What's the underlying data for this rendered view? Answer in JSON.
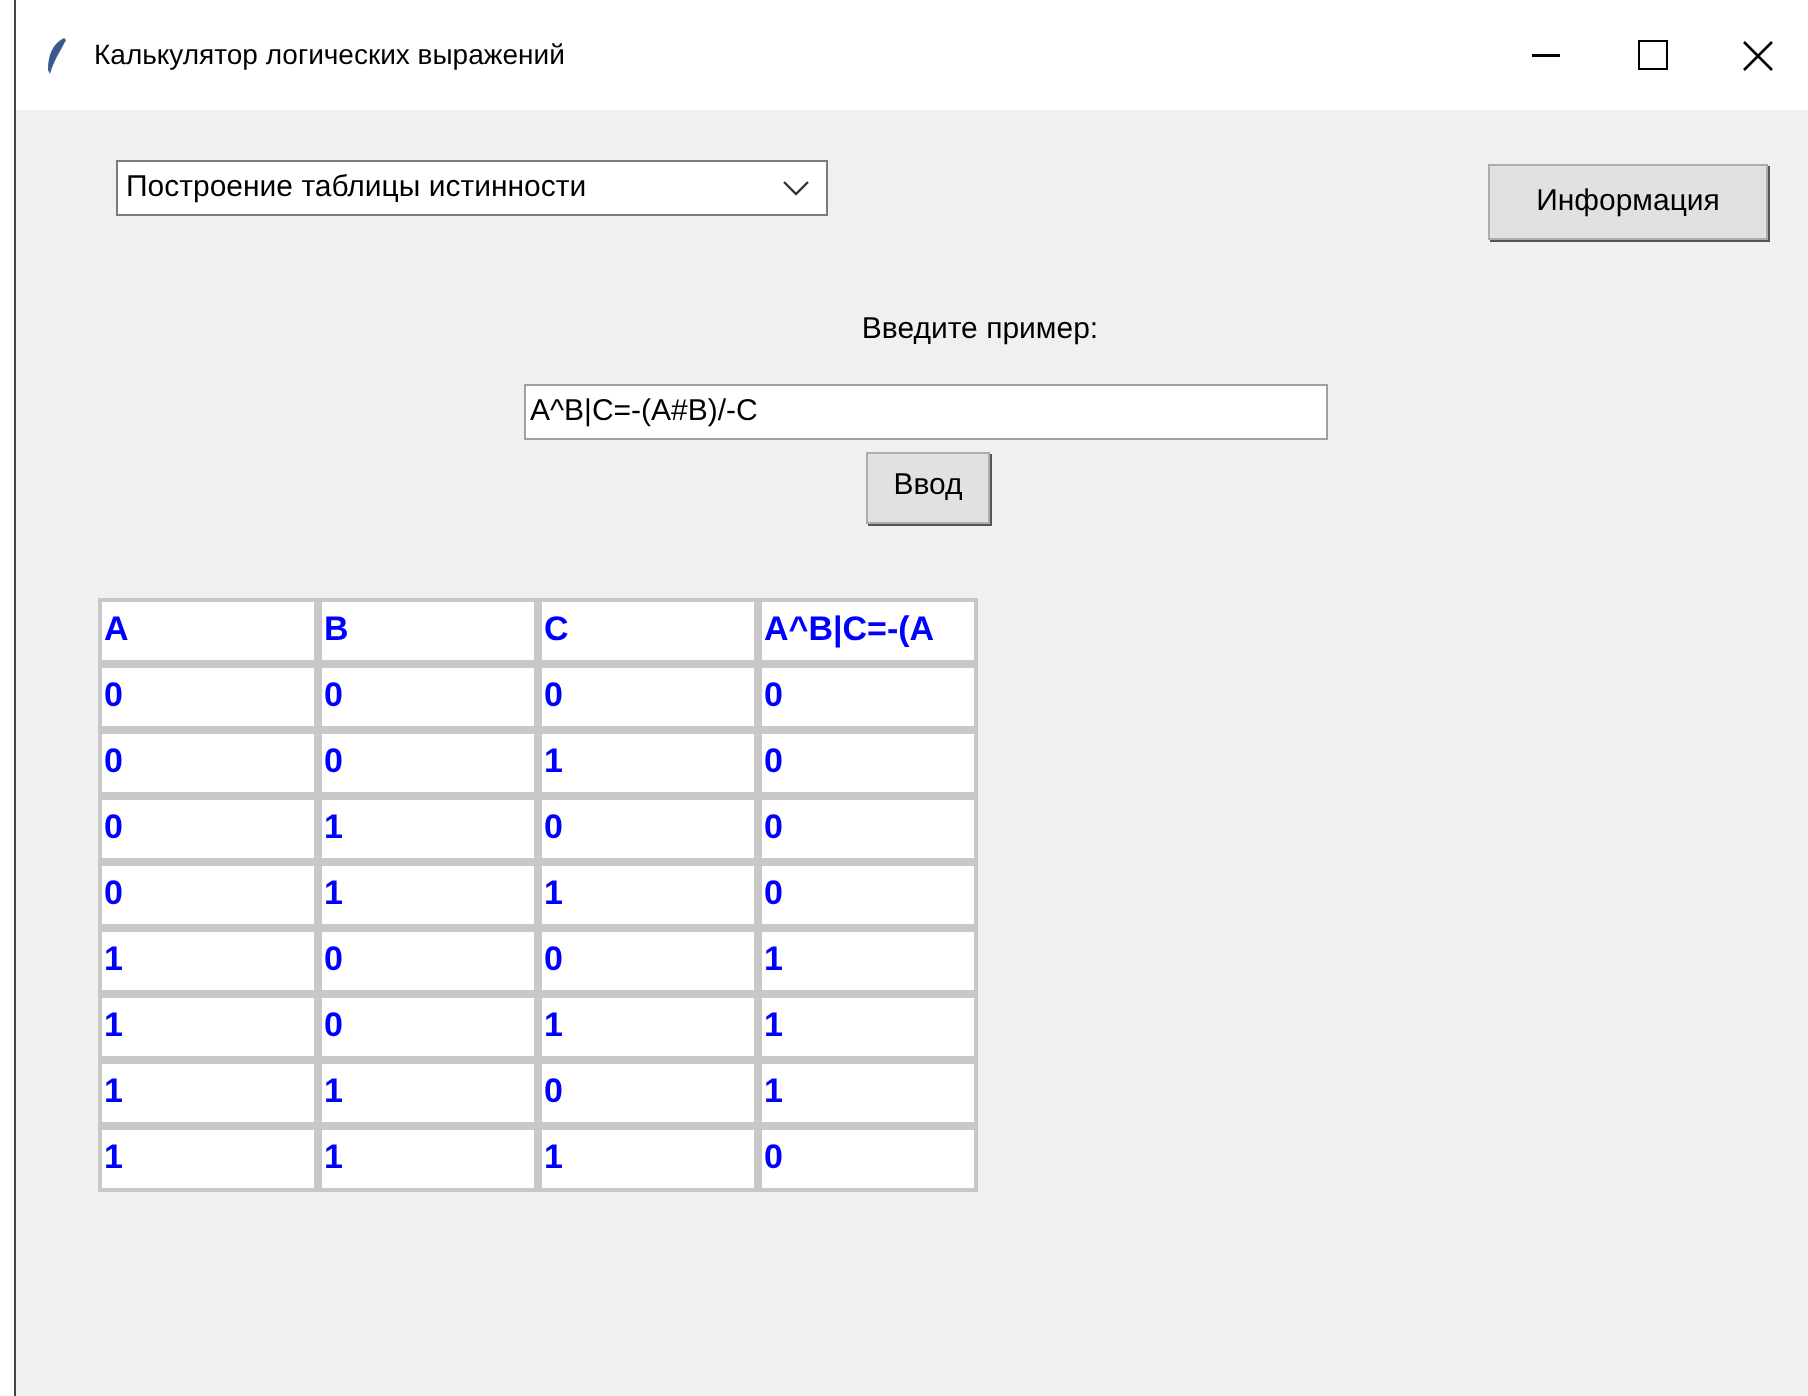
{
  "window": {
    "title": "Калькулятор логических выражений"
  },
  "mode_select": {
    "value": "Построение таблицы истинности"
  },
  "info_button": "Информация",
  "prompt_label": "Введите пример:",
  "expression_field": {
    "value": "A^B|C=-(A#B)/-C"
  },
  "submit_button": "Ввод",
  "table": {
    "columns": [
      "A",
      "B",
      "C",
      "A^B|C=-(A"
    ],
    "rows": [
      [
        "0",
        "0",
        "0",
        "0"
      ],
      [
        "0",
        "0",
        "1",
        "0"
      ],
      [
        "0",
        "1",
        "0",
        "0"
      ],
      [
        "0",
        "1",
        "1",
        "0"
      ],
      [
        "1",
        "0",
        "0",
        "1"
      ],
      [
        "1",
        "0",
        "1",
        "1"
      ],
      [
        "1",
        "1",
        "0",
        "1"
      ],
      [
        "1",
        "1",
        "1",
        "0"
      ]
    ]
  }
}
